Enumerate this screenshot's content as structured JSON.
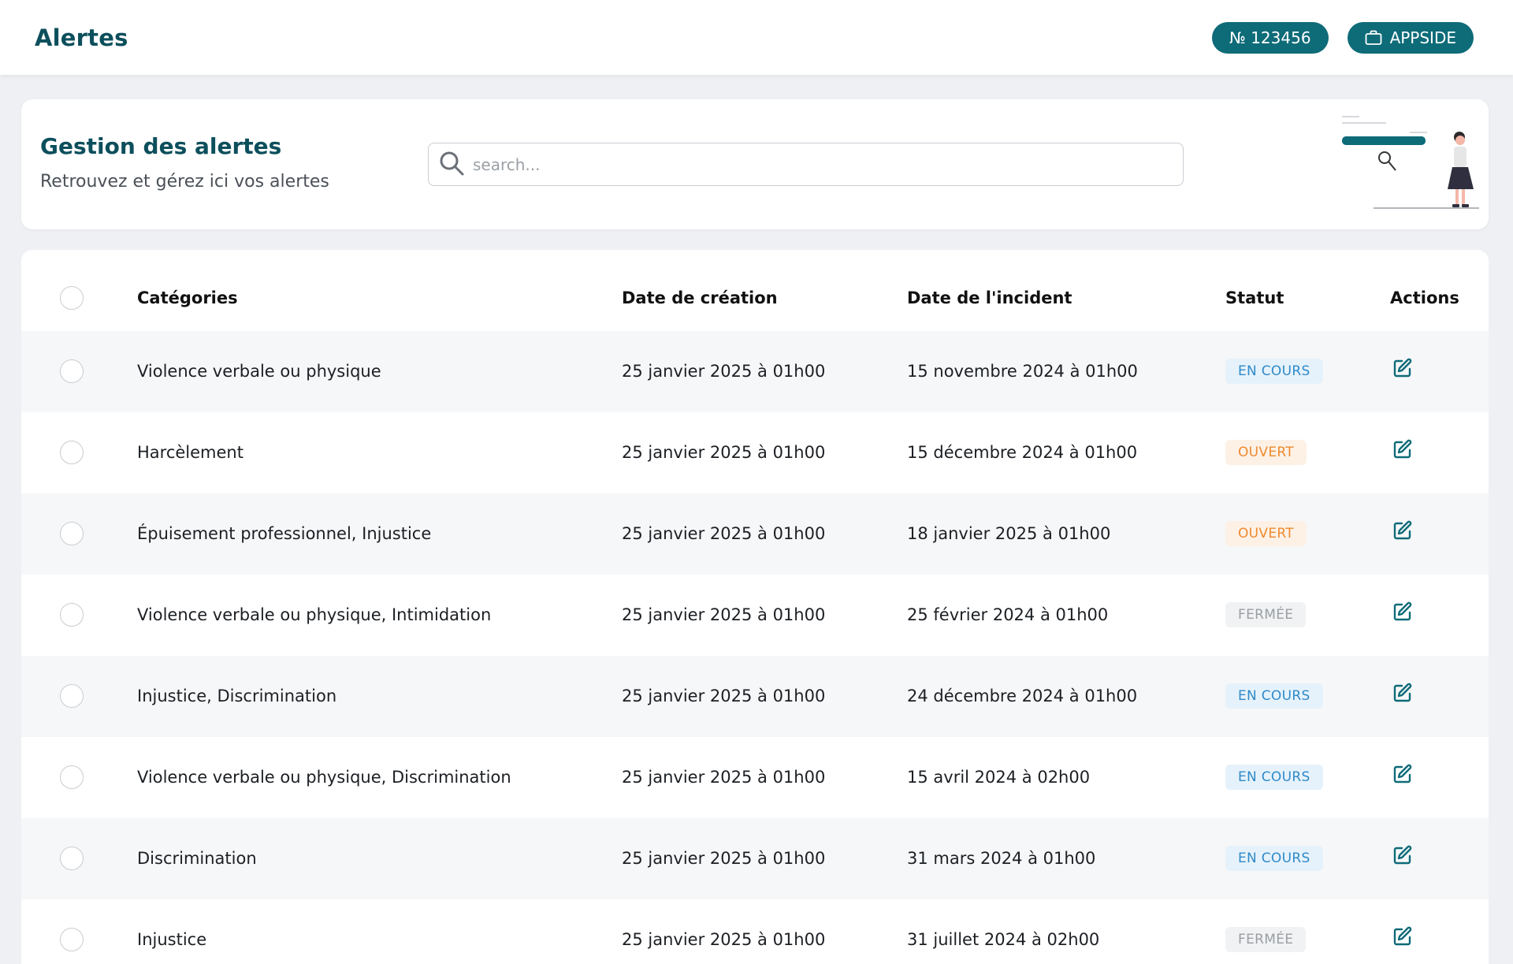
{
  "topbar": {
    "title": "Alertes",
    "number_label": "№ 123456",
    "company_label": "APPSIDE"
  },
  "header": {
    "title": "Gestion des alertes",
    "subtitle": "Retrouvez et gérez ici vos alertes",
    "search_placeholder": "search..."
  },
  "table": {
    "columns": {
      "categories": "Catégories",
      "created": "Date de création",
      "incident": "Date de l'incident",
      "status": "Statut",
      "actions": "Actions"
    },
    "rows": [
      {
        "categories": "Violence verbale ou physique",
        "created": "25 janvier 2025 à 01h00",
        "incident": "15 novembre 2024 à 01h00",
        "status": "EN COURS"
      },
      {
        "categories": "Harcèlement",
        "created": "25 janvier 2025 à 01h00",
        "incident": "15 décembre 2024 à 01h00",
        "status": "OUVERT"
      },
      {
        "categories": "Épuisement professionnel, Injustice",
        "created": "25 janvier 2025 à 01h00",
        "incident": "18 janvier 2025 à 01h00",
        "status": "OUVERT"
      },
      {
        "categories": "Violence verbale ou physique, Intimidation",
        "created": "25 janvier 2025 à 01h00",
        "incident": "25 février 2024 à 01h00",
        "status": "FERMÉE"
      },
      {
        "categories": "Injustice, Discrimination",
        "created": "25 janvier 2025 à 01h00",
        "incident": "24 décembre 2024 à 01h00",
        "status": "EN COURS"
      },
      {
        "categories": "Violence verbale ou physique, Discrimination",
        "created": "25 janvier 2025 à 01h00",
        "incident": "15 avril 2024 à 02h00",
        "status": "EN COURS"
      },
      {
        "categories": "Discrimination",
        "created": "25 janvier 2025 à 01h00",
        "incident": "31 mars 2024 à 01h00",
        "status": "EN COURS"
      },
      {
        "categories": "Injustice",
        "created": "25 janvier 2025 à 01h00",
        "incident": "31 juillet 2024 à 02h00",
        "status": "FERMÉE"
      }
    ]
  },
  "colors": {
    "brand": "#0e6b78",
    "title": "#0c4f5c",
    "status_en_cours_bg": "#e6f2fb",
    "status_en_cours_fg": "#2f8ac9",
    "status_ouvert_bg": "#fdf1e6",
    "status_ouvert_fg": "#ee8a2e",
    "status_fermee_bg": "#f1f2f3",
    "status_fermee_fg": "#9a9ea3"
  }
}
